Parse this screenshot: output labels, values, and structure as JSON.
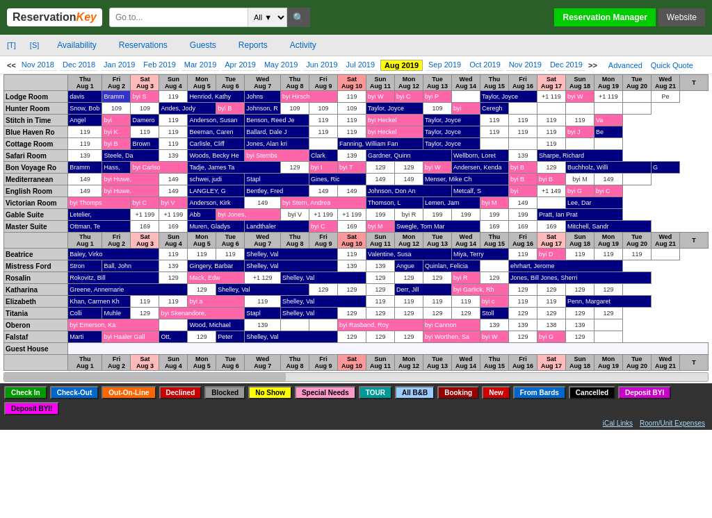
{
  "header": {
    "logo_text": "Reservation",
    "logo_key": "Key",
    "search_placeholder": "Go to...",
    "search_dropdown": "All",
    "reservation_manager_label": "Reservation Manager",
    "website_label": "Website"
  },
  "nav": {
    "availability_t": "[T]",
    "availability_s": "[S]",
    "availability_label": "Availability",
    "reservations": "Reservations",
    "guests": "Guests",
    "reports": "Reports",
    "activity": "Activity"
  },
  "months": {
    "prev_arrow": "<<",
    "next_arrow": ">>",
    "items": [
      "Nov 2018",
      "Dec 2018",
      "Jan 2019",
      "Feb 2019",
      "Mar 2019",
      "Apr 2019",
      "May 2019",
      "Jun 2019",
      "Jul 2019",
      "Aug 2019",
      "Sep 2019",
      "Oct 2019",
      "Nov 2019",
      "Dec 2019"
    ],
    "current": "Aug 2019",
    "advanced": "Advanced",
    "quick_quote": "Quick Quote"
  },
  "rooms": [
    "Lodge Room",
    "Hunter Room",
    "Stitch in Time",
    "Blue Haven Ro",
    "Cottage Room",
    "Safari Room",
    "Bon Voyage Ro",
    "Mediterranean",
    "English Room",
    "Victorian Room",
    "Gable Suite",
    "Master Suite"
  ],
  "second_section_rooms": [
    "Beatrice",
    "Mistress Ford",
    "Rosalin",
    "Katharina",
    "Elizabeth",
    "Titania",
    "Oberon",
    "Falstaf",
    "Guest House"
  ],
  "legend": {
    "items": [
      {
        "label": "Check In",
        "class": "legend-green"
      },
      {
        "label": "Check-Out",
        "class": "legend-blue"
      },
      {
        "label": "Out-On-Line",
        "class": "legend-orange"
      },
      {
        "label": "Declined",
        "class": "legend-red"
      },
      {
        "label": "Blocked",
        "class": "legend-gray"
      },
      {
        "label": "No Show",
        "class": "legend-yellow"
      },
      {
        "label": "Special Needs",
        "class": "legend-pink"
      },
      {
        "label": "TOUR",
        "class": "legend-teal"
      },
      {
        "label": "All B&B",
        "class": "legend-light-blue"
      },
      {
        "label": "Booking",
        "class": "legend-dark-red"
      },
      {
        "label": "New",
        "class": "legend-red"
      },
      {
        "label": "From Bards",
        "class": "legend-blue"
      },
      {
        "label": "Cancelled",
        "class": "legend-black"
      },
      {
        "label": "Deposit BYI",
        "class": "legend-purple"
      },
      {
        "label": "Deposit BYI!",
        "class": "legend-magenta"
      }
    ]
  },
  "bottom_links": [
    "iCal Links",
    "Room/Unit Expenses"
  ],
  "tour_label": "Tour"
}
